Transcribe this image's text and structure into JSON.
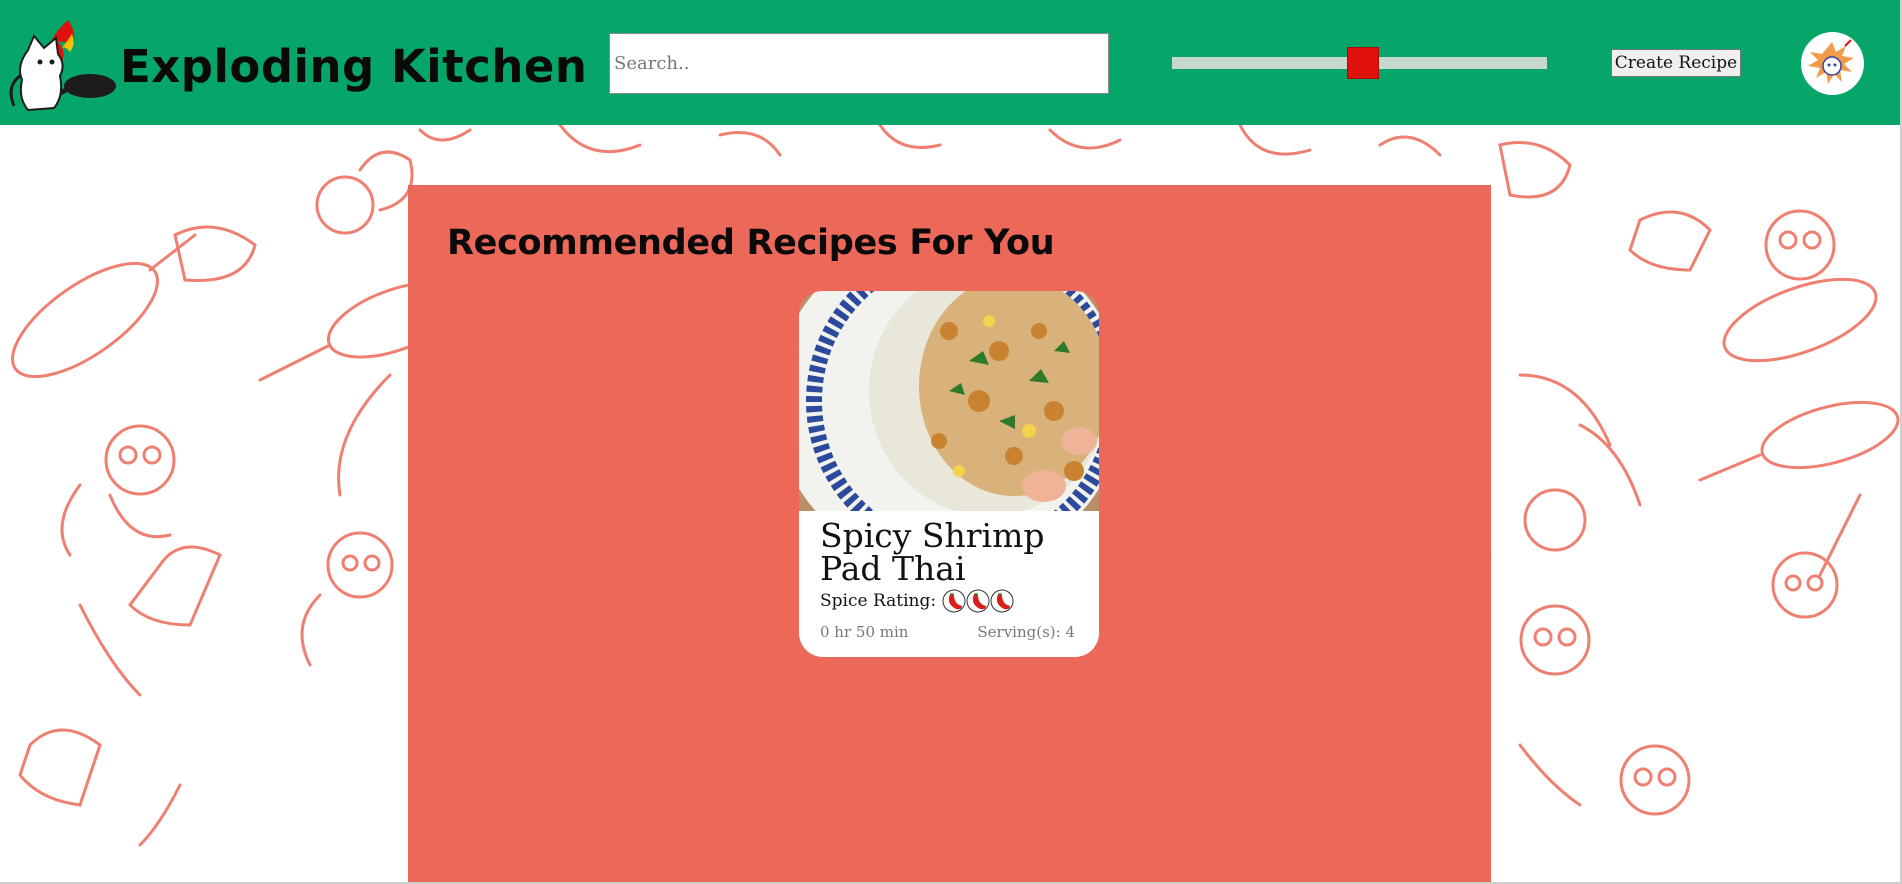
{
  "header": {
    "site_name": "Exploding Kitchen",
    "search_placeholder": "Search..",
    "search_value": "",
    "spice_slider_value": 0.5,
    "create_button_label": "Create Recipe"
  },
  "icons": {
    "logo": "cat-with-flaming-pan-icon",
    "avatar": "exploding-cat-avatar-icon",
    "pepper": "chili-pepper-icon"
  },
  "colors": {
    "header_bg": "#06a66b",
    "panel_bg": "#ec6858",
    "slider_thumb": "#e0100d",
    "pattern_stroke": "#ec6858"
  },
  "main": {
    "title": "Recommended Recipes For You",
    "recipes": [
      {
        "name": "Spicy Shrimp Pad Thai",
        "spice_label": "Spice Rating:",
        "spice_rating": 3,
        "time": "0 hr 50 min",
        "servings": "Serving(s): 4"
      }
    ]
  }
}
